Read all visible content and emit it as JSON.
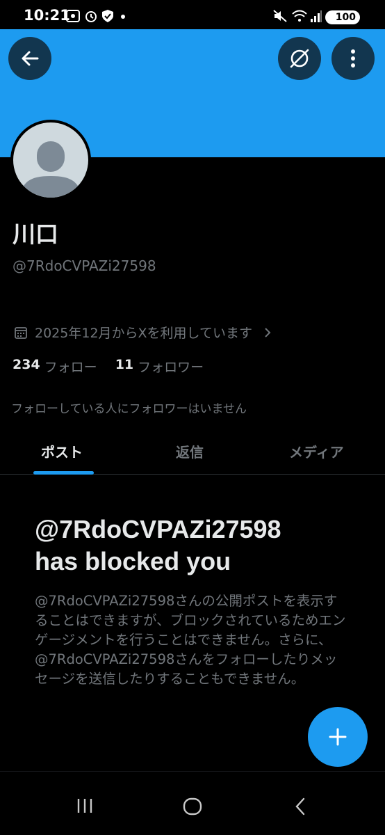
{
  "status_bar": {
    "time": "10:21",
    "battery": "100",
    "icons": [
      "screenshot-icon",
      "alarm-icon",
      "shield-icon",
      "dot-icon",
      "mute-icon",
      "wifi-icon",
      "signal-icon",
      "battery-icon"
    ]
  },
  "header": {
    "back_icon": "back-arrow-icon",
    "grok_icon": "grok-icon",
    "more_icon": "more-vertical-icon",
    "banner_color": "#1d9bf0"
  },
  "profile": {
    "display_name": "川口",
    "handle": "@7RdoCVPAZi27598",
    "joined": "2025年12月からXを利用しています",
    "following_count": "234",
    "following_label": "フォロー",
    "followers_count": "11",
    "followers_label": "フォロワー",
    "mutual_note": "フォローしている人にフォロワーはいません"
  },
  "tabs": [
    {
      "label": "ポスト",
      "active": true
    },
    {
      "label": "返信",
      "active": false
    },
    {
      "label": "メディア",
      "active": false
    }
  ],
  "blocked": {
    "title_line1": "@7RdoCVPAZi27598",
    "title_line2": "has blocked you",
    "body": "@7RdoCVPAZi27598さんの公開ポストを表示することはできますが、ブロックされているためエンゲージメントを行うことはできません。さらに、@7RdoCVPAZi27598さんをフォローしたりメッセージを送信したりすることもできません。"
  },
  "fab": {
    "icon": "plus-icon"
  },
  "nav_bar": {
    "icons": [
      "recent-apps-icon",
      "home-icon",
      "nav-back-icon"
    ]
  },
  "colors": {
    "accent": "#1d9bf0",
    "background": "#000000",
    "secondary_text": "#71767b"
  }
}
